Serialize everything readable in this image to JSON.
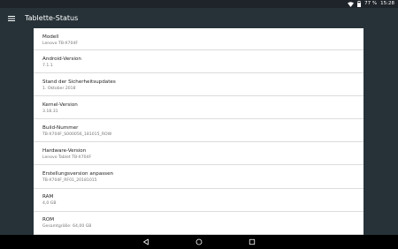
{
  "status_bar": {
    "battery_percent": "77 %",
    "time": "15:28",
    "icons": [
      "wifi-icon",
      "battery-icon"
    ]
  },
  "app_bar": {
    "title": "Tablette-Status",
    "menu_icon": "hamburger-menu-icon"
  },
  "rows": [
    {
      "title": "Modell",
      "value": "Lenovo TB-X704F"
    },
    {
      "title": "Android-Version",
      "value": "7.1.1"
    },
    {
      "title": "Stand der Sicherheitsupdates",
      "value": "1. Oktober 2018"
    },
    {
      "title": "Kernel-Version",
      "value": "3.18.31"
    },
    {
      "title": "Build-Nummer",
      "value": "TB-X704F_S000056_181015_ROW"
    },
    {
      "title": "Hardware-Version",
      "value": "Lenovo Tablet TB-X704F"
    },
    {
      "title": "Erstellungsversion anpassen",
      "value": "TB-X704F_RF01_20181015"
    },
    {
      "title": "RAM",
      "value": "4,0 GB"
    },
    {
      "title": "ROM",
      "value": "Gesamtgröße: 64,00 GB"
    }
  ],
  "nav_bar": {
    "icons": [
      "back-icon",
      "home-icon",
      "recents-icon"
    ]
  },
  "colors": {
    "app_bar": "#263238",
    "content_bg": "#ffffff",
    "nav_bar": "#000000",
    "divider": "#dcdcdc"
  }
}
